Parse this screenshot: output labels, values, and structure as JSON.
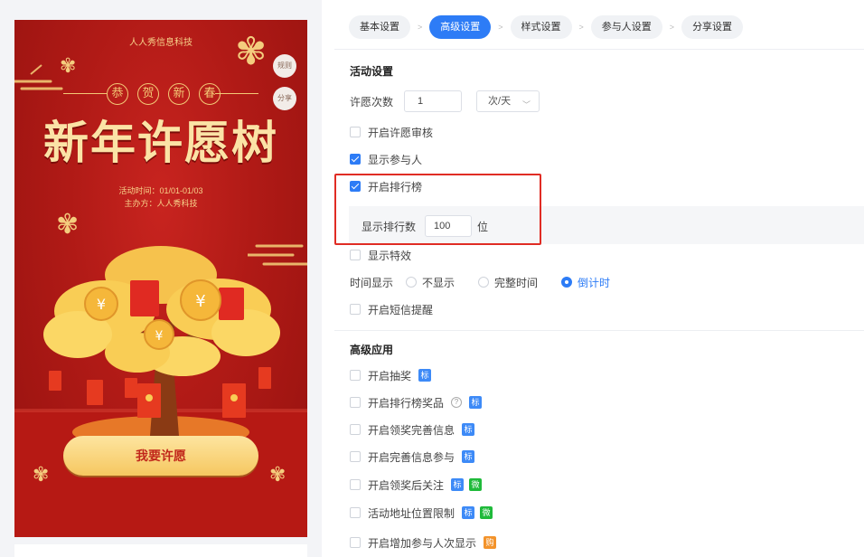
{
  "poster": {
    "org": "人人秀信息科技",
    "greeting": [
      "恭",
      "贺",
      "新",
      "春"
    ],
    "title": "新年许愿树",
    "time": "活动时间：01/01-01/03",
    "host": "主办方：人人秀科技",
    "rules_label": "规则",
    "share_label": "分享",
    "wish_button": "我要许愿"
  },
  "steps": [
    {
      "label": "基本设置",
      "active": false
    },
    {
      "label": "高级设置",
      "active": true
    },
    {
      "label": "样式设置",
      "active": false
    },
    {
      "label": "参与人设置",
      "active": false
    },
    {
      "label": "分享设置",
      "active": false
    }
  ],
  "activity": {
    "section_title": "活动设置",
    "limit_label": "许愿次数",
    "limit_value": "1",
    "limit_unit": "次/天",
    "review_label": "开启许愿审核",
    "show_participants_label": "显示参与人",
    "leaderboard_label": "开启排行榜",
    "rank_count_label": "显示排行数",
    "rank_count_value": "100",
    "rank_count_unit": "位",
    "effects_label": "显示特效",
    "time_display_label": "时间显示",
    "time_options": [
      "不显示",
      "完整时间",
      "倒计时"
    ],
    "time_selected": "倒计时",
    "sms_label": "开启短信提醒"
  },
  "advanced": {
    "section_title": "高级应用",
    "items": [
      {
        "label": "开启抽奖",
        "tags": [
          "标"
        ]
      },
      {
        "label": "开启排行榜奖品",
        "tags": [
          "标"
        ]
      },
      {
        "label": "开启领奖完善信息",
        "tags": [
          "标"
        ]
      },
      {
        "label": "开启完善信息参与",
        "tags": [
          "标"
        ]
      },
      {
        "label": "开启领奖后关注",
        "tags": [
          "标",
          "微"
        ]
      },
      {
        "label": "活动地址位置限制",
        "tags": [
          "标",
          "微"
        ]
      },
      {
        "label": "开启增加参与人次显示",
        "tags": [
          "购"
        ]
      }
    ]
  },
  "colors": {
    "accent": "#2d7cf6",
    "highlight": "#e02c24",
    "poster_red": "#b01a16",
    "gold": "#f6c760"
  }
}
